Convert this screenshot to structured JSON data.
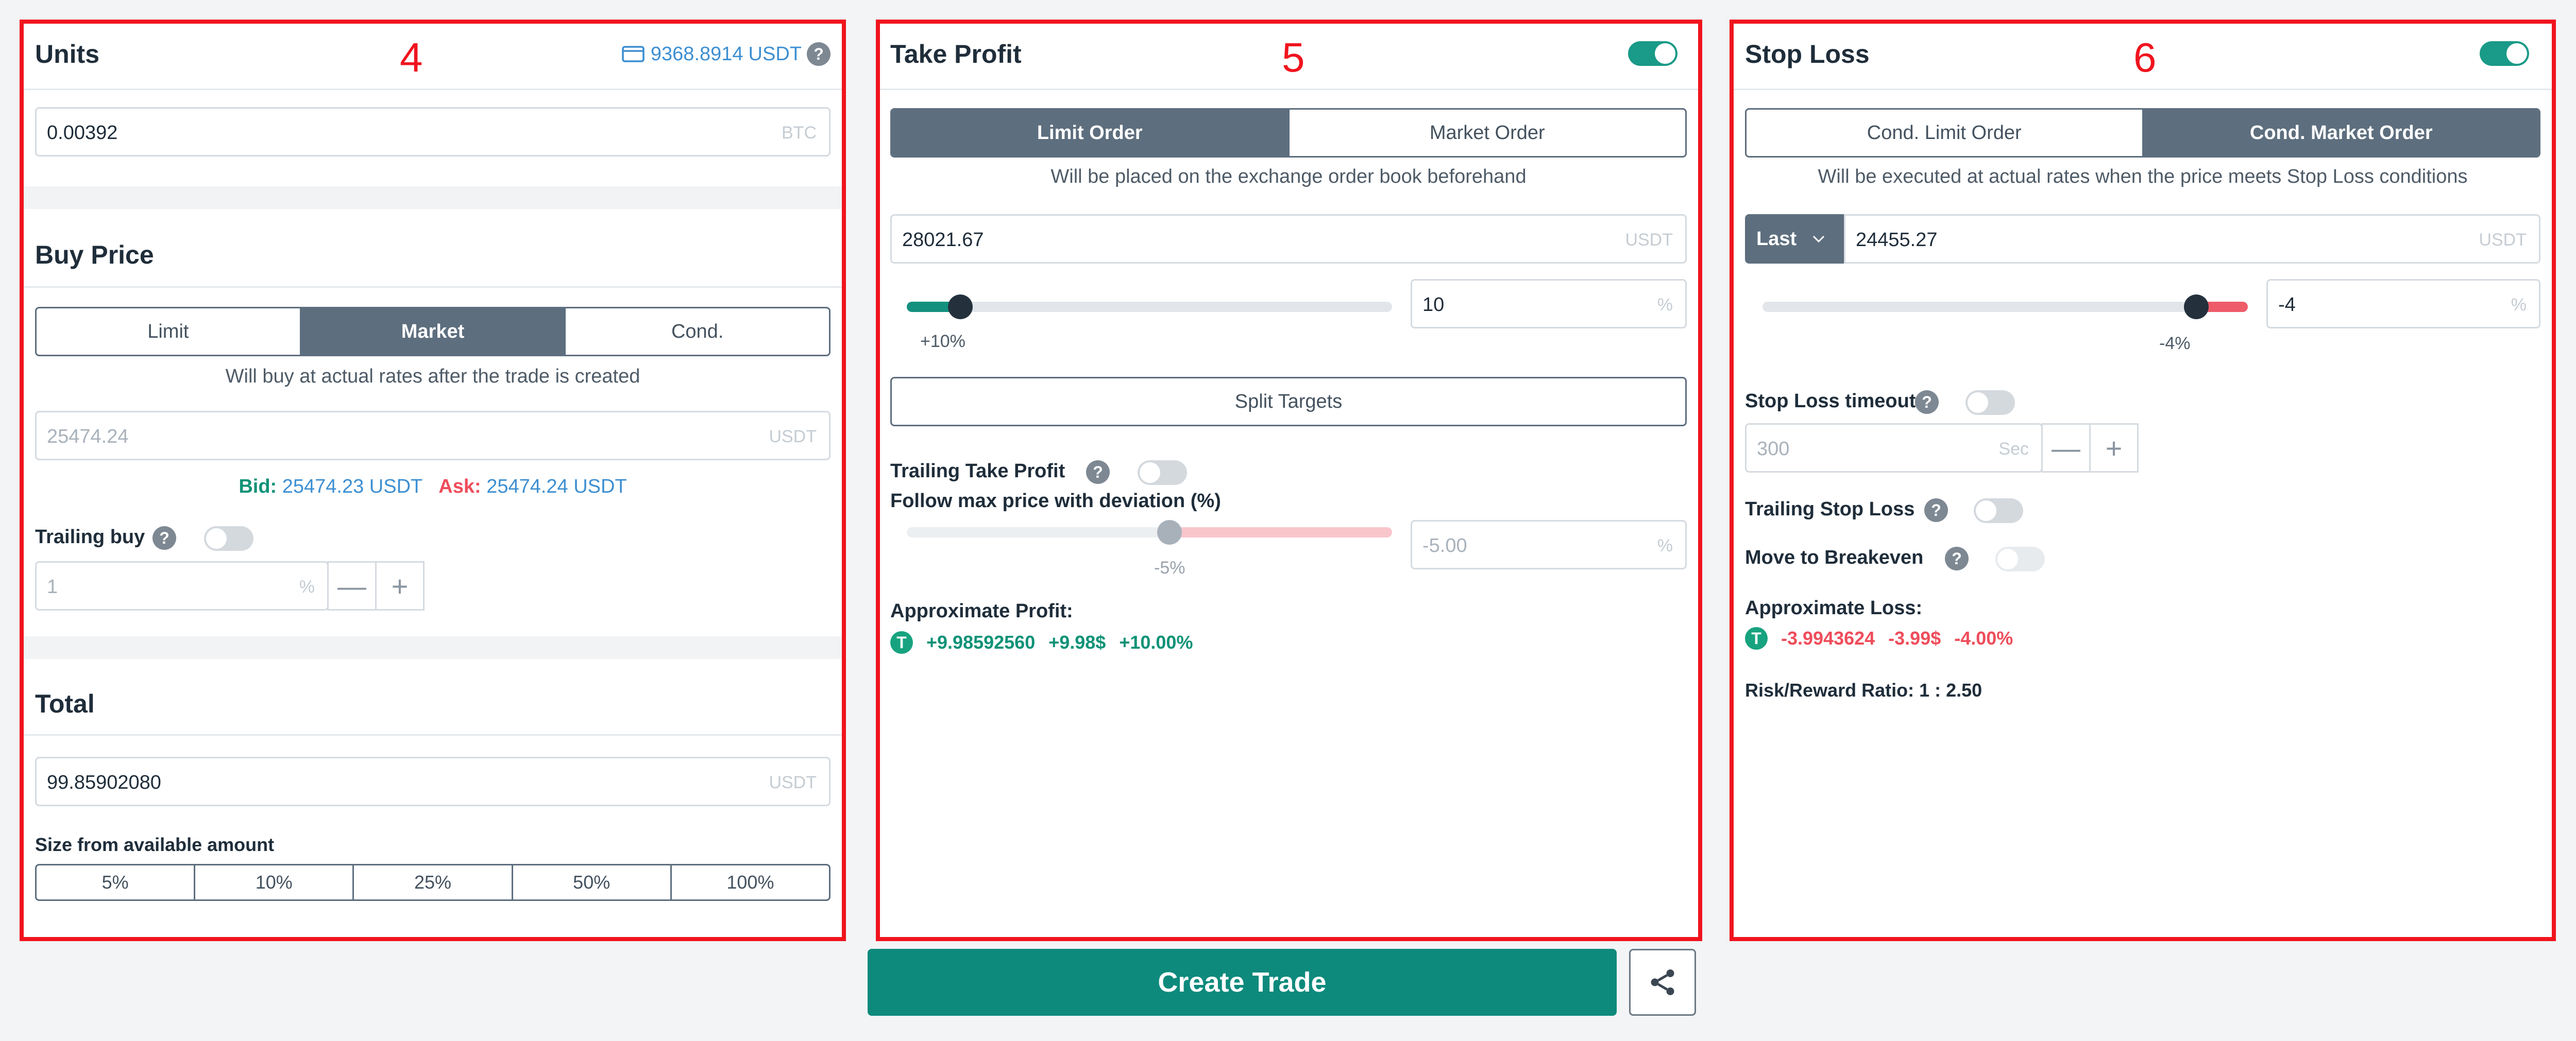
{
  "units_panel": {
    "title": "Units",
    "number": "4",
    "balance": "9368.8914",
    "balance_unit": "USDT",
    "units_value": "0.00392",
    "units_unit": "BTC",
    "buy_price": {
      "title": "Buy Price",
      "tabs": [
        "Limit",
        "Market",
        "Cond."
      ],
      "active_tab": "Market",
      "note": "Will buy at actual rates after the trade is created",
      "price_value": "25474.24",
      "price_unit": "USDT",
      "bid_label": "Bid:",
      "bid_value": "25474.23 USDT",
      "ask_label": "Ask:",
      "ask_value": "25474.24 USDT",
      "trailing_label": "Trailing buy",
      "trailing_value": "1",
      "trailing_unit": "%",
      "trailing_on": false
    },
    "total": {
      "title": "Total",
      "value": "99.85902080",
      "unit": "USDT",
      "size_label": "Size from available amount",
      "options": [
        "5%",
        "10%",
        "25%",
        "50%",
        "100%"
      ]
    }
  },
  "take_profit": {
    "title": "Take Profit",
    "number": "5",
    "enabled": true,
    "tabs": [
      "Limit Order",
      "Market Order"
    ],
    "active_tab": "Limit Order",
    "note": "Will be placed on the exchange order book beforehand",
    "price_value": "28021.67",
    "price_unit": "USDT",
    "slider_label": "+10%",
    "slider_fraction": 0.11,
    "percent_value": "10",
    "percent_unit": "%",
    "split_label": "Split Targets",
    "trailing_label": "Trailing Take Profit",
    "trailing_on": false,
    "deviation_label": "Follow max price with deviation (%)",
    "deviation_slider_label": "-5%",
    "deviation_value": "-5.00",
    "deviation_unit": "%",
    "approx_label": "Approximate Profit:",
    "approx_amount": "+9.98592560",
    "approx_usd": "+9.98$",
    "approx_pct": "+10.00%"
  },
  "stop_loss": {
    "title": "Stop Loss",
    "number": "6",
    "enabled": true,
    "tabs": [
      "Cond. Limit Order",
      "Cond. Market Order"
    ],
    "active_tab": "Cond. Market Order",
    "note": "Will be executed at actual rates when the price meets Stop Loss conditions",
    "price_type": "Last",
    "price_value": "24455.27",
    "price_unit": "USDT",
    "slider_label": "-4%",
    "percent_value": "-4",
    "percent_unit": "%",
    "timeout_label": "Stop Loss timeout",
    "timeout_value": "300",
    "timeout_unit": "Sec",
    "trailing_label": "Trailing Stop Loss",
    "breakeven_label": "Move to Breakeven",
    "approx_label": "Approximate Loss:",
    "approx_amount": "-3.9943624",
    "approx_usd": "-3.99$",
    "approx_pct": "-4.00%",
    "risk_reward": "Risk/Reward Ratio: 1 : 2.50"
  },
  "footer": {
    "create_label": "Create Trade"
  },
  "colors": {
    "accent": "#0d8a7c",
    "highlight_border": "#f0141e",
    "positive": "#0e9277",
    "negative": "#ee4d5b",
    "link": "#3d8fd1"
  }
}
